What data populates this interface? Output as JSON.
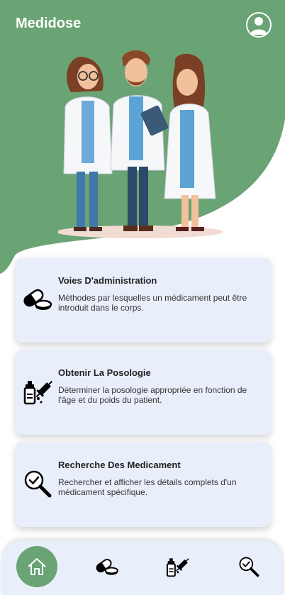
{
  "header": {
    "app_title": "Medidose",
    "profile_icon": "user-circle-icon",
    "background_color": "#6aa374"
  },
  "cards": [
    {
      "icon": "pill-capsule-icon",
      "title": "Voies D'administration",
      "description": "Méthodes par lesquelles un médicament peut être introduit dans le corps."
    },
    {
      "icon": "syringe-bottle-icon",
      "title": "Obtenir La Posologie",
      "description": "Déterminer la posologie appropriée en fonction de l'âge et du poids du patient."
    },
    {
      "icon": "search-check-icon",
      "title": "Recherche Des Medicament",
      "description": "Rechercher et afficher les détails complets d'un médicament spécifique."
    }
  ],
  "bottom_nav": {
    "items": [
      "home-icon",
      "pill-capsule-icon",
      "syringe-bottle-icon",
      "search-check-icon"
    ],
    "active": "home-icon",
    "active_color": "#6aa374"
  },
  "colors": {
    "card_background": "#e9eefb",
    "hero_green": "#6aa374"
  }
}
